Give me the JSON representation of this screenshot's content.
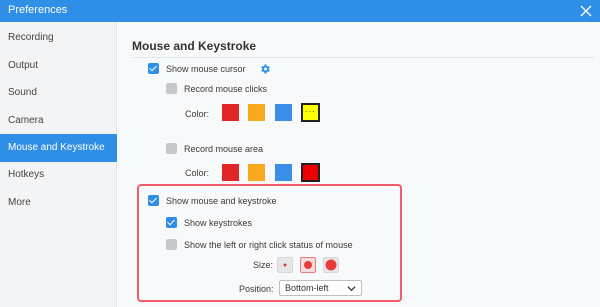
{
  "window": {
    "title": "Preferences",
    "close_icon": "close-icon"
  },
  "sidebar": {
    "items": [
      {
        "label": "Recording",
        "active": false
      },
      {
        "label": "Output",
        "active": false
      },
      {
        "label": "Sound",
        "active": false
      },
      {
        "label": "Camera",
        "active": false
      },
      {
        "label": "Mouse and Keystroke",
        "active": true
      },
      {
        "label": "Hotkeys",
        "active": false
      },
      {
        "label": "More",
        "active": false
      }
    ]
  },
  "main": {
    "section_title": "Mouse and Keystroke",
    "show_mouse_cursor": {
      "label": "Show mouse cursor",
      "checked": true,
      "settings_icon": "gear-icon"
    },
    "record_mouse_clicks": {
      "label": "Record mouse clicks",
      "checked": false,
      "color_label": "Color:",
      "colors": [
        "#e02626",
        "#f7a81b",
        "#3a8fe6",
        "#ffff00"
      ],
      "selected_color": 3
    },
    "record_mouse_area": {
      "label": "Record mouse area",
      "checked": false,
      "color_label": "Color:",
      "colors": [
        "#e02626",
        "#f7a81b",
        "#3a8fe6",
        "#ee0000"
      ],
      "selected_color": 3
    },
    "show_mouse_and_keystroke": {
      "label": "Show mouse and keystroke",
      "checked": true
    },
    "show_keystrokes": {
      "label": "Show keystrokes",
      "checked": true
    },
    "show_click_status": {
      "label": "Show the left or right click status of mouse",
      "checked": false,
      "size_label": "Size:",
      "sizes": [
        "small",
        "medium",
        "large"
      ],
      "selected_size": 1,
      "position_label": "Position:",
      "position_value": "Bottom-left",
      "position_icon": "chevron-down-icon"
    }
  },
  "colors": {
    "accent": "#2f8fe6",
    "highlight_border": "#f25c6c"
  }
}
